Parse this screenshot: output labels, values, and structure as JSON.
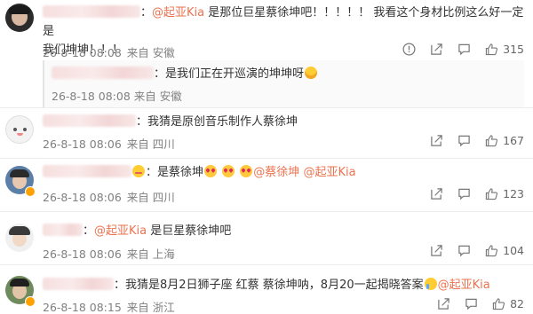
{
  "comments": [
    {
      "id": 1,
      "mention": "@起亚Kia",
      "text_line1": " 是那位巨星蔡徐坤吧！！！！！ 我看这个身材比例这么好一定是",
      "text_line2": "我们坤坤！！！",
      "date": "26-8-18 08:08",
      "source": "来自 安徽",
      "likes": "315",
      "reply": {
        "text": "：是我们正在开巡演的坤坤呀",
        "date": "26-8-18 08:08",
        "source": "来自 安徽"
      }
    },
    {
      "id": 2,
      "text": "：我猜是原创音乐制作人蔡徐坤",
      "date": "26-8-18 08:06",
      "source": "来自 四川",
      "likes": "167"
    },
    {
      "id": 3,
      "text_prefix": "：是蔡徐坤",
      "mention1": "@蔡徐坤",
      "mention2": "@起亚Kia",
      "date": "26-8-18 08:06",
      "source": "来自 四川",
      "likes": "123"
    },
    {
      "id": 4,
      "prefix": "：",
      "mention": "@起亚Kia",
      "text": " 是巨星蔡徐坤吧",
      "date": "26-8-18 08:06",
      "source": "来自 上海",
      "likes": "104"
    },
    {
      "id": 5,
      "text": "：我猜是8月2日狮子座 红蔡 蔡徐坤呐，8月20一起揭晓答案",
      "mention": "@起亚Kia",
      "date": "26-8-18 08:15",
      "source": "来自 浙江",
      "likes": "82"
    }
  ],
  "icons": {
    "report": "exclamation-circle-icon",
    "share": "share-icon",
    "comment": "comment-icon",
    "like": "thumbs-up-icon"
  },
  "colors": {
    "mention": "#eb7350",
    "meta": "#808080",
    "icon": "#777777"
  }
}
